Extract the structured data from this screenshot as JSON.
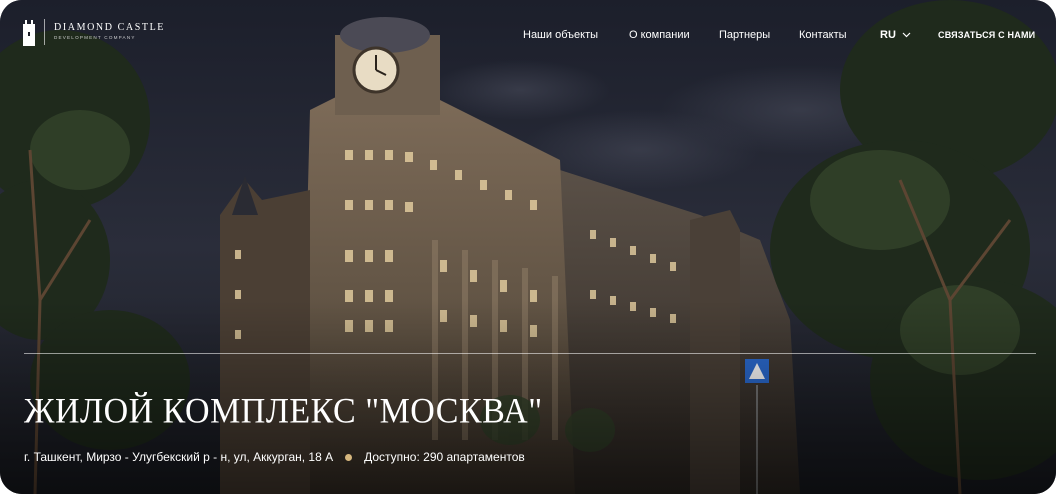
{
  "brand": {
    "name": "DIAMOND CASTLE",
    "tagline": "DEVELOPMENT COMPANY",
    "logo_icon": "castle-tower-icon"
  },
  "nav": {
    "items": [
      {
        "label": "Наши объекты"
      },
      {
        "label": "О компании"
      },
      {
        "label": "Партнеры"
      },
      {
        "label": "Контакты"
      }
    ],
    "language": "RU",
    "language_icon": "chevron-down-icon",
    "cta_label": "СВЯЗАТЬСЯ С НАМИ"
  },
  "hero": {
    "title": "ЖИЛОЙ КОМПЛЕКС \"МОСКВА\"",
    "address": "г. Ташкент, Мирзо - Улугбекский р - н, ул, Аккурган, 18 А",
    "availability": "Доступно: 290 апартаментов",
    "accent_color": "#d6b77e"
  }
}
